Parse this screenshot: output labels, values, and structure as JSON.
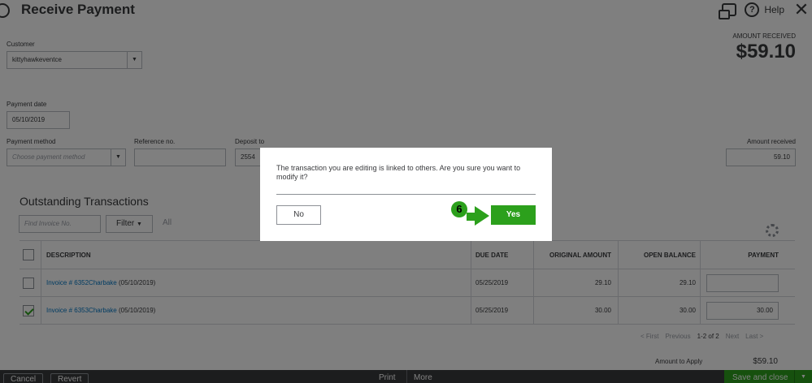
{
  "header": {
    "title": "Receive Payment",
    "help_label": "Help"
  },
  "form": {
    "customer_label": "Customer",
    "customer_value": "kittyhawkeventce",
    "payment_date_label": "Payment date",
    "payment_date_value": "05/10/2019",
    "payment_method_label": "Payment method",
    "payment_method_placeholder": "Choose payment method",
    "reference_label": "Reference no.",
    "reference_value": "",
    "deposit_label": "Deposit to",
    "deposit_value": "2554",
    "amount_received_label": "Amount received",
    "amount_received_value": "59.10"
  },
  "amount_summary": {
    "label": "AMOUNT RECEIVED",
    "value": "$59.10"
  },
  "outstanding": {
    "title": "Outstanding Transactions",
    "find_placeholder": "Find Invoice No.",
    "filter_label": "Filter",
    "all_label": "All",
    "columns": [
      "DESCRIPTION",
      "DUE DATE",
      "ORIGINAL AMOUNT",
      "OPEN BALANCE",
      "PAYMENT"
    ],
    "rows": [
      {
        "invoice": "Invoice # 6352Charbake",
        "date_suffix": " (05/10/2019)",
        "due_date": "05/25/2019",
        "original": "29.10",
        "open_balance": "29.10",
        "payment": "",
        "checked": false
      },
      {
        "invoice": "Invoice # 6353Charbake",
        "date_suffix": " (05/10/2019)",
        "due_date": "05/25/2019",
        "original": "30.00",
        "open_balance": "30.00",
        "payment": "30.00",
        "checked": true
      }
    ],
    "pager": {
      "first": "< First",
      "previous": "Previous",
      "current": "1-2 of 2",
      "next": "Next",
      "last": "Last >"
    },
    "amount_to_apply_label": "Amount to Apply",
    "amount_to_apply_value": "$59.10"
  },
  "footer": {
    "cancel": "Cancel",
    "revert": "Revert",
    "print": "Print",
    "more": "More",
    "save_close": "Save and close"
  },
  "dialog": {
    "message": "The transaction you are editing is linked to others. Are you sure you want to modify it?",
    "no_label": "No",
    "yes_label": "Yes"
  },
  "annotation": {
    "step_number": "6"
  },
  "colors": {
    "accent_green": "#2ca01c",
    "link_blue": "#0077c5",
    "text_dark": "#393a3d"
  }
}
